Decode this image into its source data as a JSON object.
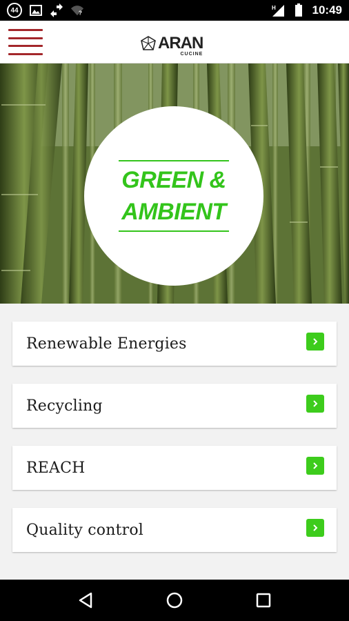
{
  "status_bar": {
    "notification_count": "44",
    "time": "10:49",
    "icons": [
      "notification-badge-icon",
      "image-icon",
      "sync-icon",
      "wifi-icon",
      "signal-icon",
      "battery-icon"
    ]
  },
  "header": {
    "brand": "ARAN",
    "brand_sub": "CUCINE"
  },
  "hero": {
    "title_line1": "GREEN &",
    "title_line2": "AMBIENT"
  },
  "menu": {
    "items": [
      {
        "label": "Renewable Energies"
      },
      {
        "label": "Recycling"
      },
      {
        "label": "REACH"
      },
      {
        "label": "Quality control"
      }
    ]
  },
  "colors": {
    "accent_green": "#3dcc1c",
    "title_green": "#33c41b",
    "hamburger_red": "#a3262a"
  },
  "nav_bar": {
    "buttons": [
      "back-icon",
      "home-icon",
      "recents-icon"
    ]
  }
}
